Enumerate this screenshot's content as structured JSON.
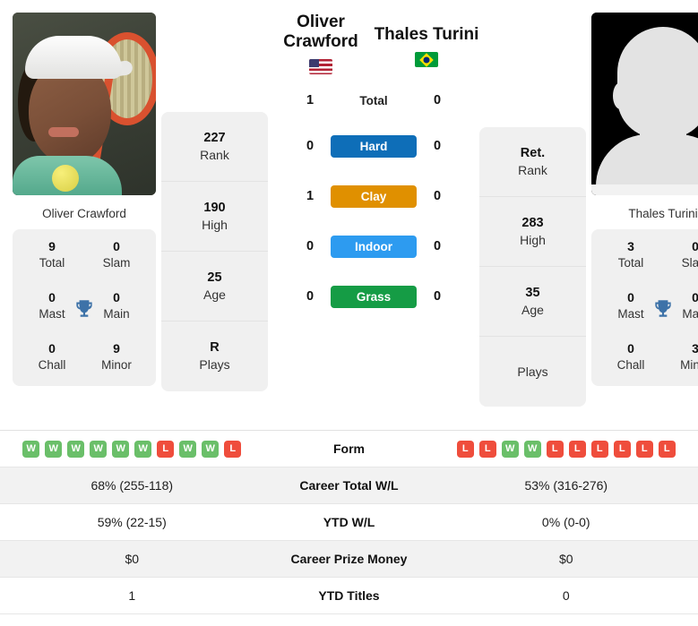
{
  "players": {
    "left": {
      "first_name": "Oliver",
      "last_name": "Crawford",
      "full_name": "Oliver Crawford",
      "photo_caption": "Oliver Crawford",
      "flag": "us-flag-icon",
      "rank": "227",
      "rank_label": "Rank",
      "high": "190",
      "high_label": "High",
      "age": "25",
      "age_label": "Age",
      "plays": "R",
      "plays_label": "Plays",
      "titles": {
        "total": "9",
        "total_label": "Total",
        "slam": "0",
        "slam_label": "Slam",
        "mast": "0",
        "mast_label": "Mast",
        "main": "0",
        "main_label": "Main",
        "chall": "0",
        "chall_label": "Chall",
        "minor": "9",
        "minor_label": "Minor"
      },
      "surface_wins": {
        "total": "1",
        "hard": "0",
        "clay": "1",
        "indoor": "0",
        "grass": "0"
      },
      "form": [
        "W",
        "W",
        "W",
        "W",
        "W",
        "W",
        "L",
        "W",
        "W",
        "L"
      ],
      "career_wl": "68% (255-118)",
      "ytd_wl": "59% (22-15)",
      "career_prize": "$0",
      "ytd_titles": "1"
    },
    "right": {
      "first_name": "Thales",
      "last_name": "Turini",
      "full_name": "Thales Turini",
      "photo_caption": "Thales Turini",
      "flag": "br-flag-icon",
      "rank": "Ret.",
      "rank_label": "Rank",
      "high": "283",
      "high_label": "High",
      "age": "35",
      "age_label": "Age",
      "plays": "",
      "plays_label": "Plays",
      "titles": {
        "total": "3",
        "total_label": "Total",
        "slam": "0",
        "slam_label": "Slam",
        "mast": "0",
        "mast_label": "Mast",
        "main": "0",
        "main_label": "Main",
        "chall": "0",
        "chall_label": "Chall",
        "minor": "3",
        "minor_label": "Minor"
      },
      "surface_wins": {
        "total": "0",
        "hard": "0",
        "clay": "0",
        "indoor": "0",
        "grass": "0"
      },
      "form": [
        "L",
        "L",
        "W",
        "W",
        "L",
        "L",
        "L",
        "L",
        "L",
        "L"
      ],
      "career_wl": "53% (316-276)",
      "ytd_wl": "0% (0-0)",
      "career_prize": "$0",
      "ytd_titles": "0"
    }
  },
  "surfaces": [
    {
      "key": "total",
      "label": "Total",
      "color": "transparent",
      "text_color": "#222222"
    },
    {
      "key": "hard",
      "label": "Hard",
      "color": "#0E6EB8",
      "text_color": "#ffffff"
    },
    {
      "key": "clay",
      "label": "Clay",
      "color": "#E09000",
      "text_color": "#ffffff"
    },
    {
      "key": "indoor",
      "label": "Indoor",
      "color": "#2D9BF0",
      "text_color": "#ffffff"
    },
    {
      "key": "grass",
      "label": "Grass",
      "color": "#159C45",
      "text_color": "#ffffff"
    }
  ],
  "table_rows": [
    {
      "label": "Form",
      "key": "form",
      "type": "form"
    },
    {
      "label": "Career Total W/L",
      "key": "career_wl",
      "type": "text"
    },
    {
      "label": "YTD W/L",
      "key": "ytd_wl",
      "type": "text"
    },
    {
      "label": "Career Prize Money",
      "key": "career_prize",
      "type": "text"
    },
    {
      "label": "YTD Titles",
      "key": "ytd_titles",
      "type": "text"
    }
  ],
  "colors": {
    "win_badge": "#6ABF69",
    "loss_badge": "#EF4D3C",
    "trophy": "#3D72A8",
    "card_bg": "#f0f0f0",
    "row_alt_bg": "#f2f2f2"
  }
}
